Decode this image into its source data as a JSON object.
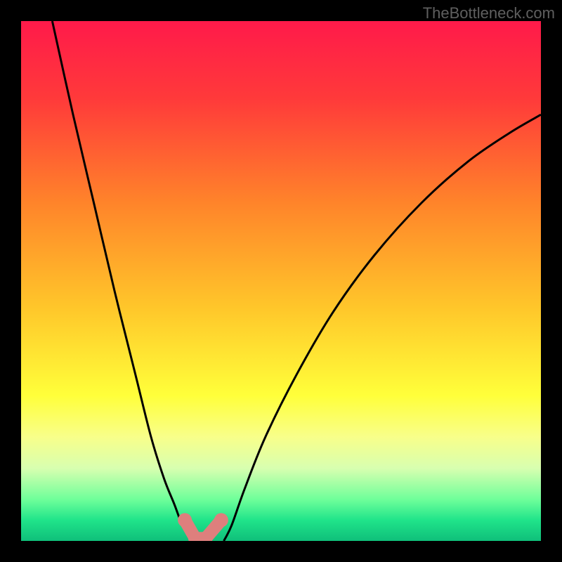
{
  "watermark": "TheBottleneck.com",
  "chart_data": {
    "type": "line",
    "title": "",
    "xlabel": "",
    "ylabel": "",
    "xlim": [
      0,
      100
    ],
    "ylim": [
      0,
      100
    ],
    "grid": false,
    "background_gradient": {
      "stops": [
        {
          "offset": 0.0,
          "color": "#ff1a4a"
        },
        {
          "offset": 0.15,
          "color": "#ff3a3a"
        },
        {
          "offset": 0.35,
          "color": "#ff842a"
        },
        {
          "offset": 0.55,
          "color": "#ffc62a"
        },
        {
          "offset": 0.72,
          "color": "#ffff3a"
        },
        {
          "offset": 0.8,
          "color": "#f8ff8a"
        },
        {
          "offset": 0.86,
          "color": "#d8ffb0"
        },
        {
          "offset": 0.92,
          "color": "#6fff9a"
        },
        {
          "offset": 0.96,
          "color": "#20e48a"
        },
        {
          "offset": 1.0,
          "color": "#0fbf7a"
        }
      ]
    },
    "series": [
      {
        "name": "left-descending",
        "x": [
          6,
          10,
          14,
          18,
          22,
          25,
          27.5,
          29.5,
          31,
          32.2,
          33
        ],
        "y": [
          100,
          82,
          65,
          48,
          32,
          20,
          12,
          7,
          3,
          1,
          0
        ]
      },
      {
        "name": "right-ascending",
        "x": [
          39,
          40.5,
          43,
          47,
          53,
          60,
          68,
          77,
          86,
          94,
          100
        ],
        "y": [
          0,
          3,
          10,
          20,
          32,
          44,
          55,
          65,
          73,
          78.5,
          82
        ]
      }
    ],
    "annotations": {
      "trough_markers_x": [
        31.5,
        33.5,
        35.5,
        38.5
      ],
      "trough_markers_y": [
        4,
        0.5,
        0.5,
        4
      ],
      "trough_segment": {
        "x1": 33.5,
        "y1": 0.5,
        "x2": 35.5,
        "y2": 0.5
      }
    },
    "colors": {
      "curve": "#000000",
      "marker": "#de7f7d"
    }
  }
}
